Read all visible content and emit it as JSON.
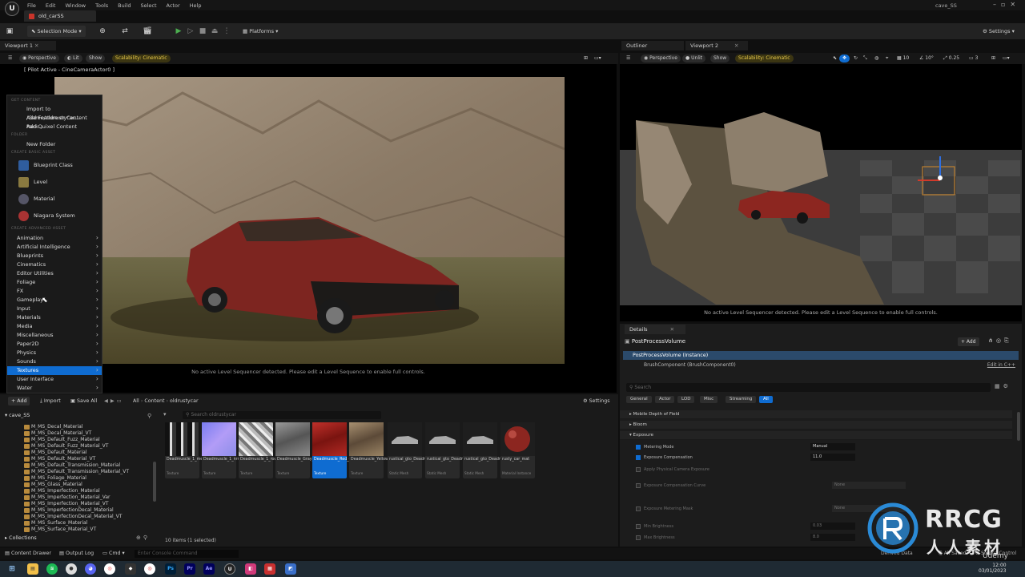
{
  "menubar": {
    "items": [
      "File",
      "Edit",
      "Window",
      "Tools",
      "Build",
      "Select",
      "Actor",
      "Help"
    ],
    "project": "cave_SS",
    "doc_tab": "old_carSS"
  },
  "toolbar": {
    "selection_mode": "Selection Mode",
    "platforms": "Platforms",
    "settings": "Settings"
  },
  "viewport1": {
    "tab": "Viewport 1",
    "view": "Perspective",
    "lit": "Lit",
    "show": "Show",
    "scalability": "Scalability: Cinematic",
    "pilot": "[ Pilot Active - CineCameraActor0 ]",
    "message": "No active Level Sequencer detected. Please edit a Level Sequence to enable full controls."
  },
  "context_menu": {
    "get_content_header": "GET CONTENT",
    "get_content": [
      "Import to /Game/oldrustycar...",
      "Add Feature or Content Pack...",
      "Add Quixel Content"
    ],
    "folder_header": "FOLDER",
    "new_folder": "New Folder",
    "basic_header": "CREATE BASIC ASSET",
    "basic": [
      "Blueprint Class",
      "Level",
      "Material",
      "Niagara System"
    ],
    "advanced_header": "CREATE ADVANCED ASSET",
    "advanced": [
      "Animation",
      "Artificial Intelligence",
      "Blueprints",
      "Cinematics",
      "Editor Utilities",
      "Foliage",
      "FX",
      "Gameplay",
      "Input",
      "Materials",
      "Media",
      "Miscellaneous",
      "Paper2D",
      "Physics",
      "Sounds",
      "Textures",
      "User Interface",
      "Water"
    ]
  },
  "outliner": {
    "tab": "Outliner"
  },
  "viewport2": {
    "tab": "Viewport 2",
    "view": "Perspective",
    "unlit": "Unlit",
    "show": "Show",
    "scalability": "Scalability: Cinematic",
    "grid": "10",
    "angle": "10°",
    "scale": "0.25",
    "cam": "3",
    "message": "No active Level Sequencer detected. Please edit a Level Sequence to enable full controls."
  },
  "details": {
    "tab": "Details",
    "object": "PostProcessVolume",
    "add": "+ Add",
    "instance": "PostProcessVolume (Instance)",
    "component": "BrushComponent (BrushComponent0)",
    "edit_cpp": "Edit in C++",
    "search_placeholder": "Search",
    "filters": [
      "General",
      "Actor",
      "LOD",
      "Misc",
      "Streaming",
      "All"
    ],
    "sections": [
      "Mobile Depth of Field",
      "Bloom",
      "Exposure"
    ],
    "props": [
      {
        "name": "Metering Mode",
        "value": "Manual",
        "on": true
      },
      {
        "name": "Exposure Compensation",
        "value": "11.0",
        "on": true
      },
      {
        "name": "Apply Physical Camera Exposure",
        "value": "",
        "on": false
      },
      {
        "name": "Exposure Compensation Curve",
        "value": "None",
        "on": false
      },
      {
        "name": "Exposure Metering Mask",
        "value": "None",
        "on": false
      },
      {
        "name": "Min Brightness",
        "value": "0.03",
        "on": false
      },
      {
        "name": "Max Brightness",
        "value": "8.0",
        "on": false
      }
    ]
  },
  "content_browser": {
    "add": "+ Add",
    "import": "Import",
    "save_all": "Save All",
    "path": [
      "All",
      "Content",
      "oldrustycar"
    ],
    "settings": "Settings",
    "root": "cave_SS",
    "search_placeholder": "Search oldrustycar",
    "tree": [
      "M_MS_Decal_Material",
      "M_MS_Decal_Material_VT",
      "M_MS_Default_Fuzz_Material",
      "M_MS_Default_Fuzz_Material_VT",
      "M_MS_Default_Material",
      "M_MS_Default_Material_VT",
      "M_MS_Default_Transmission_Material",
      "M_MS_Default_Transmission_Material_VT",
      "M_MS_Foliage_Material",
      "M_MS_Glass_Material",
      "M_MS_Imperfection_Material",
      "M_MS_Imperfection_Material_Var",
      "M_MS_Imperfection_Material_VT",
      "M_MS_ImperfectionDecal_Material",
      "M_MS_ImperfectionDecal_Material_VT",
      "M_MS_Surface_Material",
      "M_MS_Surface_Material_VT"
    ],
    "collections": "Collections",
    "assets": [
      {
        "name": "Deadmuscle_1_met",
        "type": "Texture"
      },
      {
        "name": "Deadmuscle_1_nrm",
        "type": "Texture"
      },
      {
        "name": "Deadmuscle_1_rough",
        "type": "Texture"
      },
      {
        "name": "Deadmuscle_Gray_dif",
        "type": "Texture"
      },
      {
        "name": "Deadmuscle_Red_dif",
        "type": "Texture"
      },
      {
        "name": "Deadmuscle_Yellow_dif",
        "type": "Texture"
      },
      {
        "name": "rustical_gto_Deadmuscle...",
        "type": "Static Mesh"
      },
      {
        "name": "rustical_gto_Deadmuscle...",
        "type": "Static Mesh"
      },
      {
        "name": "rustical_gto_Deadmuscle...",
        "type": "Static Mesh"
      },
      {
        "name": "rusty_car_mat",
        "type": "Material Instance"
      }
    ],
    "count": "10 items (1 selected)"
  },
  "statusbar": {
    "content_drawer": "Content Drawer",
    "output_log": "Output Log",
    "cmd": "Cmd",
    "console_placeholder": "Enter Console Command",
    "derived": "Derived Data",
    "all_saved": "All Saved",
    "source_control": "Source Control"
  },
  "taskbar": {
    "time": "12:00",
    "date": "03/01/2023"
  },
  "watermark": {
    "brand": "RRCG",
    "chinese": "人人素材",
    "udemy": "Udemy"
  },
  "colors": {
    "accent": "#0f6cd1",
    "scalability": "#e6c74a",
    "car_red": "#8c2620"
  }
}
